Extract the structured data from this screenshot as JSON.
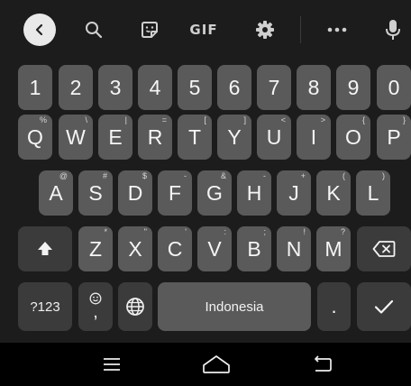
{
  "toolbar": {
    "back_icon": "chevron-left-icon",
    "search_icon": "search-icon",
    "sticker_icon": "sticker-icon",
    "gif_label": "GIF",
    "settings_icon": "gear-icon",
    "more_icon": "more-horizontal-icon",
    "mic_icon": "microphone-icon"
  },
  "number_row": [
    "1",
    "2",
    "3",
    "4",
    "5",
    "6",
    "7",
    "8",
    "9",
    "0"
  ],
  "row1": [
    {
      "k": "Q",
      "h": "%"
    },
    {
      "k": "W",
      "h": "\\"
    },
    {
      "k": "E",
      "h": "|"
    },
    {
      "k": "R",
      "h": "="
    },
    {
      "k": "T",
      "h": "["
    },
    {
      "k": "Y",
      "h": "]"
    },
    {
      "k": "U",
      "h": "<"
    },
    {
      "k": "I",
      "h": ">"
    },
    {
      "k": "O",
      "h": "{"
    },
    {
      "k": "P",
      "h": "}"
    }
  ],
  "row2": [
    {
      "k": "A",
      "h": "@"
    },
    {
      "k": "S",
      "h": "#"
    },
    {
      "k": "D",
      "h": "$"
    },
    {
      "k": "F",
      "h": "-"
    },
    {
      "k": "G",
      "h": "&"
    },
    {
      "k": "H",
      "h": "-"
    },
    {
      "k": "J",
      "h": "+"
    },
    {
      "k": "K",
      "h": "("
    },
    {
      "k": "L",
      "h": ")"
    }
  ],
  "row3": [
    {
      "k": "Z",
      "h": "*"
    },
    {
      "k": "X",
      "h": "\""
    },
    {
      "k": "C",
      "h": "'"
    },
    {
      "k": "V",
      "h": ":"
    },
    {
      "k": "B",
      "h": ";"
    },
    {
      "k": "N",
      "h": "!"
    },
    {
      "k": "M",
      "h": "?"
    }
  ],
  "bottom": {
    "symbols_label": "?123",
    "emoji_comma_label": ",",
    "space_label": "Indonesia",
    "period_label": "."
  },
  "nav": {
    "recents_icon": "menu-lines-icon",
    "home_icon": "home-icon",
    "back_icon": "back-arrow-icon"
  }
}
